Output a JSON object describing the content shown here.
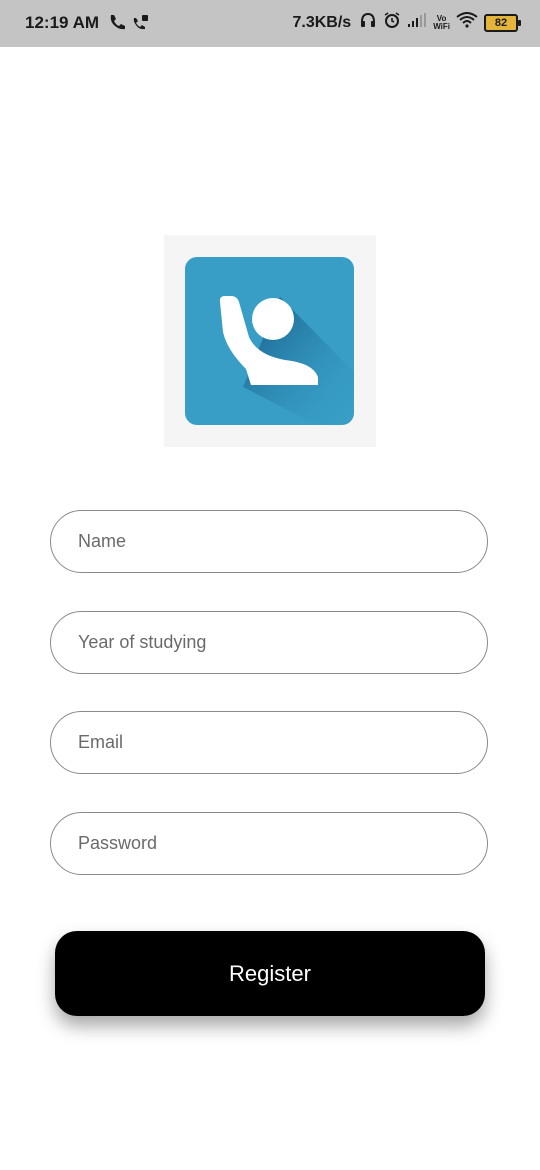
{
  "status_bar": {
    "time": "12:19 AM",
    "net_speed": "7.3KB/s",
    "vowifi_top": "Vo",
    "vowifi_bottom": "WiFi",
    "battery": "82",
    "icons": [
      "phone-icon",
      "phone-lock-icon",
      "headphones-icon",
      "alarm-icon",
      "signal-icon",
      "vowifi-icon",
      "wifi-icon",
      "battery-icon"
    ]
  },
  "logo": {
    "icon": "student-raising-hand-logo",
    "color": "#389ec6"
  },
  "form": {
    "name_placeholder": "Name",
    "year_placeholder": "Year of studying",
    "email_placeholder": "Email",
    "password_placeholder": "Password"
  },
  "register_label": "Register"
}
